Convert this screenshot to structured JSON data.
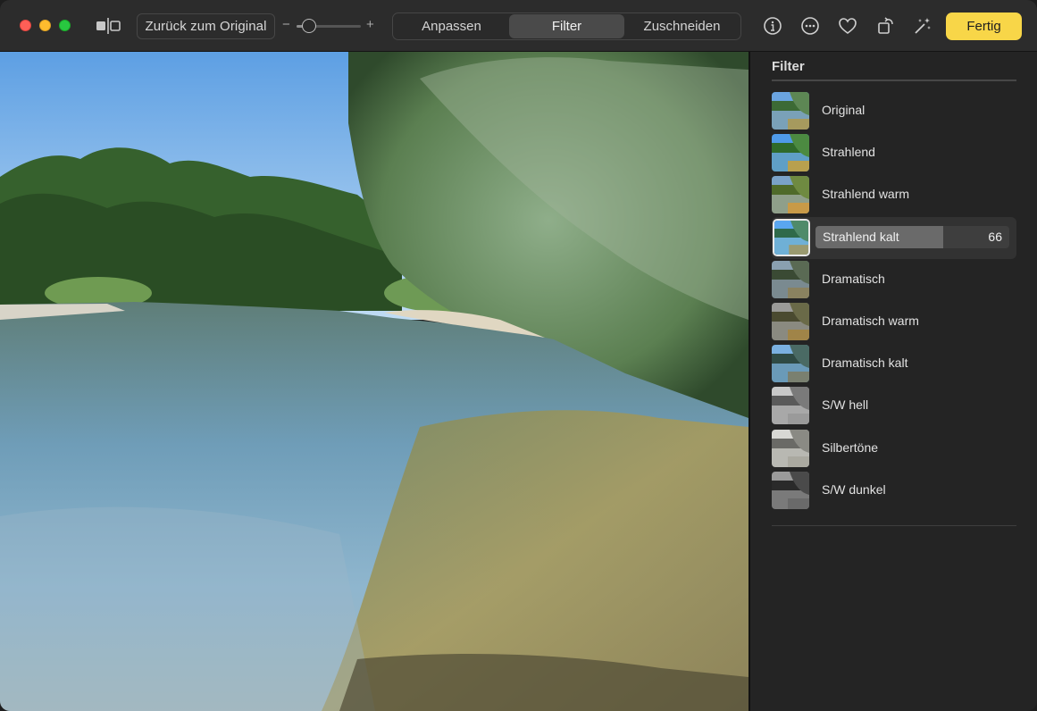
{
  "toolbar": {
    "revert_label": "Zurück zum Original",
    "zoom_minus": "−",
    "zoom_plus": "+",
    "zoom_level": 0.2,
    "tabs": [
      {
        "label": "Anpassen",
        "active": false
      },
      {
        "label": "Filter",
        "active": true
      },
      {
        "label": "Zuschneiden",
        "active": false
      }
    ],
    "icons": [
      "info-icon",
      "more-icon",
      "heart-icon",
      "rotate-icon",
      "magic-wand-icon"
    ],
    "done_label": "Fertig",
    "done_color": "#f8d648"
  },
  "panel": {
    "title": "Filter",
    "filters": [
      {
        "label": "Original",
        "tone": "color"
      },
      {
        "label": "Strahlend",
        "tone": "vivid"
      },
      {
        "label": "Strahlend warm",
        "tone": "warm"
      },
      {
        "label": "Strahlend kalt",
        "tone": "cool",
        "selected": true,
        "intensity": 66
      },
      {
        "label": "Dramatisch",
        "tone": "drama"
      },
      {
        "label": "Dramatisch warm",
        "tone": "dramawarm"
      },
      {
        "label": "Dramatisch kalt",
        "tone": "dramacool"
      },
      {
        "label": "S/W hell",
        "tone": "mono"
      },
      {
        "label": "Silbertöne",
        "tone": "silver"
      },
      {
        "label": "S/W dunkel",
        "tone": "noir"
      }
    ]
  }
}
